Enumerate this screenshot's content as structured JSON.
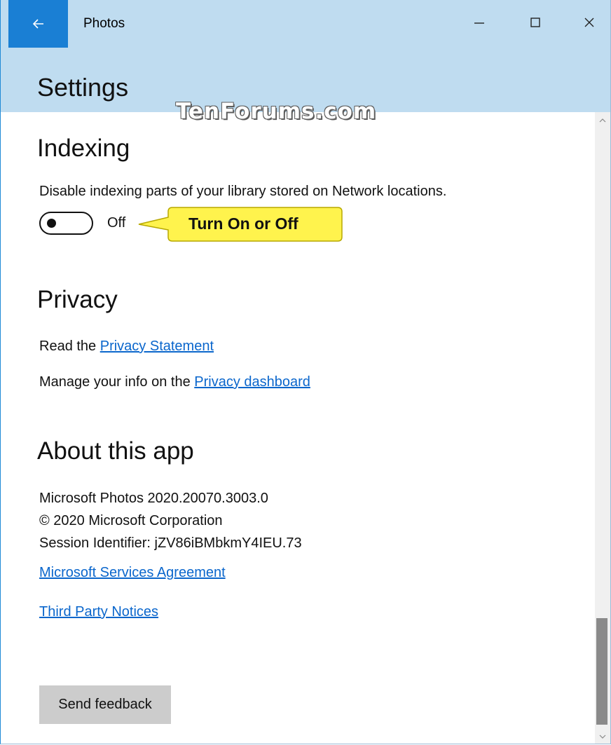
{
  "window": {
    "title": "Photos",
    "back_icon": "back-arrow-icon",
    "minimize_icon": "minimize-icon",
    "maximize_icon": "maximize-icon",
    "close_icon": "close-icon"
  },
  "header": {
    "title": "Settings",
    "watermark": "TenForums.com"
  },
  "indexing": {
    "heading": "Indexing",
    "description": "Disable indexing parts of your library stored on Network locations.",
    "toggle_state": "Off",
    "toggle_on": false,
    "callout": "Turn On or Off",
    "callout_color": "#fff34d"
  },
  "privacy": {
    "heading": "Privacy",
    "line1_prefix": "Read the ",
    "line1_link": "Privacy Statement",
    "line2_prefix": "Manage your info on the ",
    "line2_link": "Privacy dashboard"
  },
  "about": {
    "heading": "About this app",
    "version": "Microsoft Photos 2020.20070.3003.0",
    "copyright": "© 2020 Microsoft Corporation",
    "session": "Session Identifier: jZV86iBMbkmY4IEU.73",
    "services_link": "Microsoft Services Agreement",
    "notices_link": "Third Party Notices"
  },
  "feedback_button": "Send feedback",
  "colors": {
    "accent": "#1a7fd4",
    "titlebar": "#bfdcf0",
    "link": "#0a66cc"
  }
}
